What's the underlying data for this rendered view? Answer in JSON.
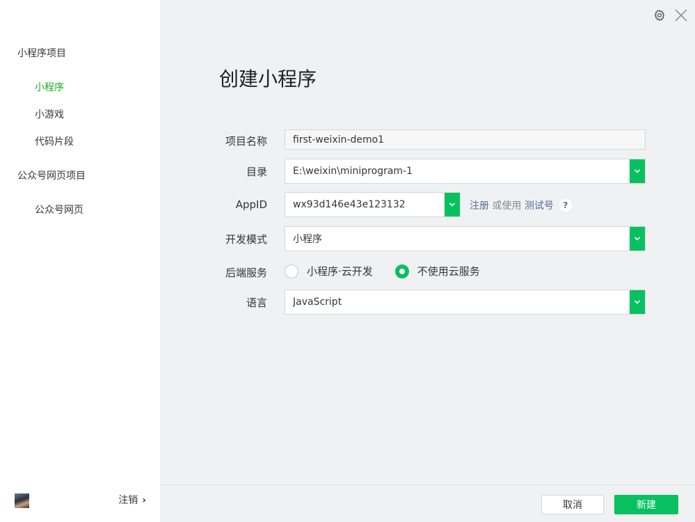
{
  "sidebar": {
    "groups": [
      {
        "label": "小程序项目"
      },
      {
        "label": "公众号网页项目"
      }
    ],
    "items": [
      {
        "label": "小程序"
      },
      {
        "label": "小游戏"
      },
      {
        "label": "代码片段"
      },
      {
        "label": "公众号网页"
      }
    ],
    "logout_label": "注销",
    "logout_chevron": "›"
  },
  "main": {
    "title": "创建小程序",
    "form": {
      "project_name": {
        "label": "项目名称",
        "value": "first-weixin-demo1"
      },
      "directory": {
        "label": "目录",
        "value": "E:\\weixin\\miniprogram-1"
      },
      "appid": {
        "label": "AppID",
        "value": "wx93d146e43e123132"
      },
      "appid_links": {
        "register": "注册",
        "or_use": " 或使用 ",
        "test_account": "测试号",
        "help": "?"
      },
      "dev_mode": {
        "label": "开发模式",
        "value": "小程序"
      },
      "backend": {
        "label": "后端服务",
        "options": [
          {
            "label": "小程序·云开发",
            "selected": false
          },
          {
            "label": "不使用云服务",
            "selected": true
          }
        ]
      },
      "language": {
        "label": "语言",
        "value": "JavaScript"
      }
    },
    "buttons": {
      "cancel": "取消",
      "create": "新建"
    }
  },
  "icons": {
    "settings": "gear-icon",
    "close": "close-icon",
    "dropdown": "chevron-down-icon"
  },
  "colors": {
    "accent": "#07c160",
    "active_nav": "#1aad19",
    "link": "#576b95",
    "sidebar_bg": "#ffffff",
    "main_bg": "#f0f1f2"
  }
}
